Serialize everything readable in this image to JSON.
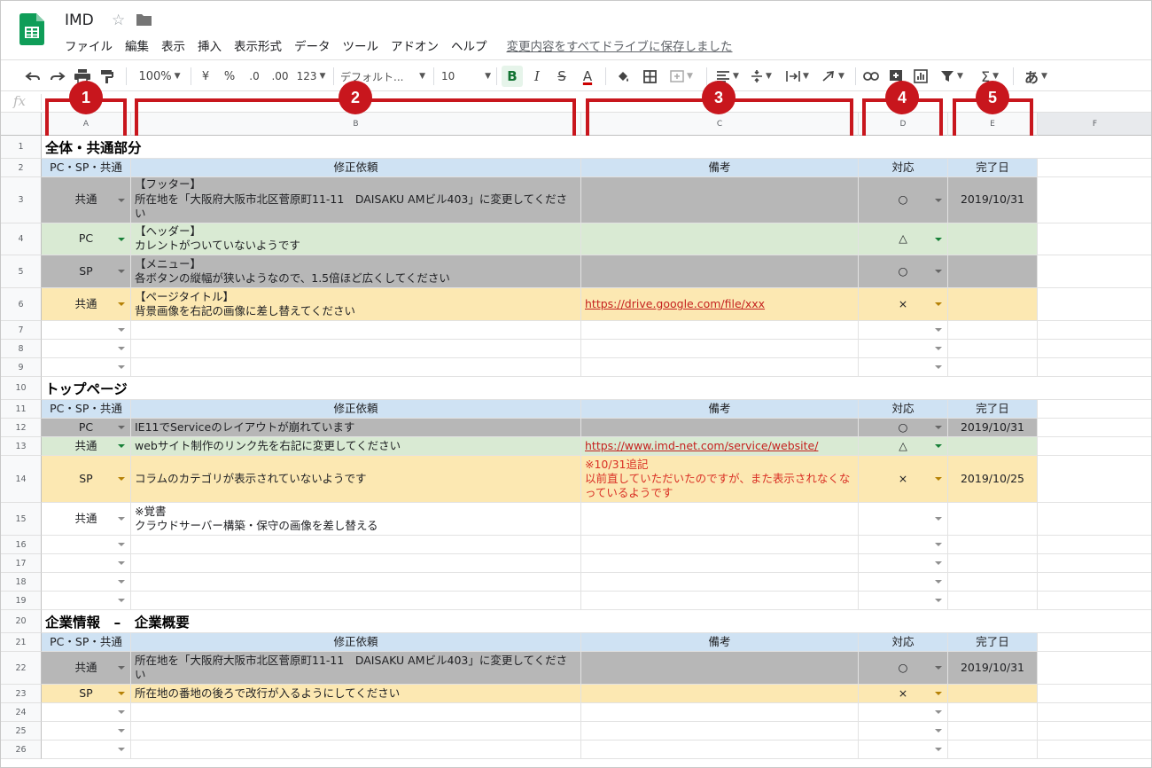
{
  "app": {
    "title": "IMD",
    "save_status": "変更内容をすべてドライブに保存しました",
    "menus": [
      "ファイル",
      "編集",
      "表示",
      "挿入",
      "表示形式",
      "データ",
      "ツール",
      "アドオン",
      "ヘルプ"
    ]
  },
  "toolbar": {
    "zoom": "100%",
    "currency": "¥",
    "percent": "%",
    "decimal_decrease": ".0",
    "decimal_increase": ".00",
    "more_formats": "123",
    "font": "デフォルト...",
    "font_size": "10",
    "bold": "B",
    "italic": "I",
    "strike": "S",
    "text_color": "A",
    "input_tool": "あ",
    "sigma": "Σ"
  },
  "formula": {
    "fx": "fx"
  },
  "columns": [
    "A",
    "B",
    "C",
    "D",
    "E",
    "F"
  ],
  "markers": [
    "1",
    "2",
    "3",
    "4",
    "5"
  ],
  "colors": {
    "grey_row": "#b7b7b7",
    "green_row": "#d9ead3",
    "yellow_row": "#fce8b2",
    "header_blue": "#cfe2f3",
    "marker_red": "#c8161d"
  },
  "rows": [
    {
      "n": "1",
      "section": "全体・共通部分"
    },
    {
      "n": "2",
      "header": true,
      "a": "PC・SP・共通",
      "b": "修正依頼",
      "c": "備考",
      "d": "対応",
      "e": "完了日"
    },
    {
      "n": "3",
      "bg": "grey",
      "a": "共通",
      "b": "【フッター】\n所在地を「大阪府大阪市北区菅原町11-11　DAISAKU AMビル403」に変更してください",
      "c": "",
      "d": "○",
      "e": "2019/10/31"
    },
    {
      "n": "4",
      "bg": "green",
      "a": "PC",
      "b": "【ヘッダー】\nカレントがついていないようです",
      "c": "",
      "d": "△",
      "e": ""
    },
    {
      "n": "5",
      "bg": "grey",
      "a": "SP",
      "b": "【メニュー】\n各ボタンの縦幅が狭いようなので、1.5倍ほど広くしてください",
      "c": "",
      "d": "○",
      "e": ""
    },
    {
      "n": "6",
      "bg": "yellow",
      "a": "共通",
      "b": "【ページタイトル】\n背景画像を右記の画像に差し替えてください",
      "c": "https://drive.google.com/file/xxx",
      "c_link": true,
      "d": "×",
      "e": ""
    },
    {
      "n": "7",
      "bg": "white",
      "a": "",
      "b": "",
      "c": "",
      "d": "",
      "e": ""
    },
    {
      "n": "8",
      "bg": "white",
      "a": "",
      "b": "",
      "c": "",
      "d": "",
      "e": ""
    },
    {
      "n": "9",
      "bg": "white",
      "a": "",
      "b": "",
      "c": "",
      "d": "",
      "e": ""
    },
    {
      "n": "10",
      "section": "トップページ"
    },
    {
      "n": "11",
      "header": true,
      "a": "PC・SP・共通",
      "b": "修正依頼",
      "c": "備考",
      "d": "対応",
      "e": "完了日"
    },
    {
      "n": "12",
      "bg": "grey",
      "a": "PC",
      "b": "IE11でServiceのレイアウトが崩れています",
      "c": "",
      "d": "○",
      "e": "2019/10/31"
    },
    {
      "n": "13",
      "bg": "green",
      "a": "共通",
      "b": "webサイト制作のリンク先を右記に変更してください",
      "c": "https://www.imd-net.com/service/website/",
      "c_link": true,
      "d": "△",
      "e": ""
    },
    {
      "n": "14",
      "bg": "yellow",
      "a": "SP",
      "b": "コラムのカテゴリが表示されていないようです",
      "c": "※10/31追記\n以前直していただいたのですが、また表示されなくなっているようです",
      "c_red": true,
      "d": "×",
      "e": "2019/10/25"
    },
    {
      "n": "15",
      "bg": "white",
      "a": "共通",
      "b": "※覚書\nクラウドサーバー構築・保守の画像を差し替える",
      "c": "",
      "d": "",
      "e": ""
    },
    {
      "n": "16",
      "bg": "white",
      "a": "",
      "b": "",
      "c": "",
      "d": "",
      "e": ""
    },
    {
      "n": "17",
      "bg": "white",
      "a": "",
      "b": "",
      "c": "",
      "d": "",
      "e": ""
    },
    {
      "n": "18",
      "bg": "white",
      "a": "",
      "b": "",
      "c": "",
      "d": "",
      "e": ""
    },
    {
      "n": "19",
      "bg": "white",
      "a": "",
      "b": "",
      "c": "",
      "d": "",
      "e": ""
    },
    {
      "n": "20",
      "section": "企業情報　–　企業概要"
    },
    {
      "n": "21",
      "header": true,
      "a": "PC・SP・共通",
      "b": "修正依頼",
      "c": "備考",
      "d": "対応",
      "e": "完了日"
    },
    {
      "n": "22",
      "bg": "grey",
      "a": "共通",
      "b": "所在地を「大阪府大阪市北区菅原町11-11　DAISAKU AMビル403」に変更してください",
      "c": "",
      "d": "○",
      "e": "2019/10/31"
    },
    {
      "n": "23",
      "bg": "yellow",
      "a": "SP",
      "b": "所在地の番地の後ろで改行が入るようにしてください",
      "c": "",
      "d": "×",
      "e": ""
    },
    {
      "n": "24",
      "bg": "white",
      "a": "",
      "b": "",
      "c": "",
      "d": "",
      "e": ""
    },
    {
      "n": "25",
      "bg": "white",
      "a": "",
      "b": "",
      "c": "",
      "d": "",
      "e": ""
    },
    {
      "n": "26",
      "bg": "white",
      "a": "",
      "b": "",
      "c": "",
      "d": "",
      "e": ""
    }
  ]
}
